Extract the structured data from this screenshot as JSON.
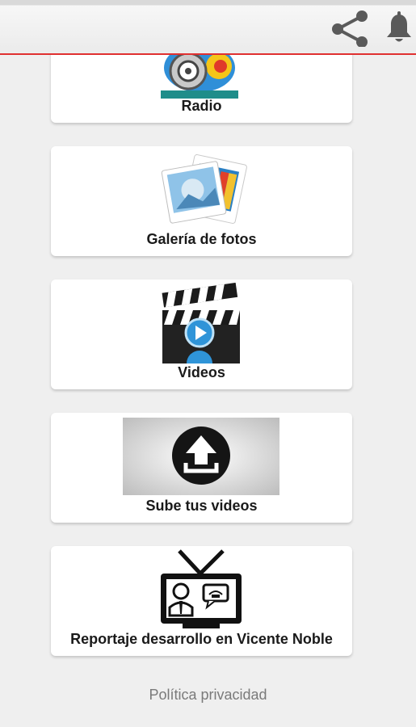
{
  "header": {
    "share_icon": "share-icon",
    "bell_icon": "bell-icon"
  },
  "menu": {
    "items": [
      {
        "label": "Radio",
        "icon": "radio-logo"
      },
      {
        "label": "Galería de fotos",
        "icon": "photo-gallery-icon"
      },
      {
        "label": "Videos",
        "icon": "video-clapper-icon"
      },
      {
        "label": "Sube tus videos",
        "icon": "upload-icon"
      },
      {
        "label": "Reportaje desarrollo en Vicente Noble",
        "icon": "tv-report-icon"
      }
    ]
  },
  "footer": {
    "privacy_label": "Política privacidad"
  },
  "colors": {
    "accent": "#e03030",
    "background": "#efefef",
    "card": "#ffffff"
  }
}
